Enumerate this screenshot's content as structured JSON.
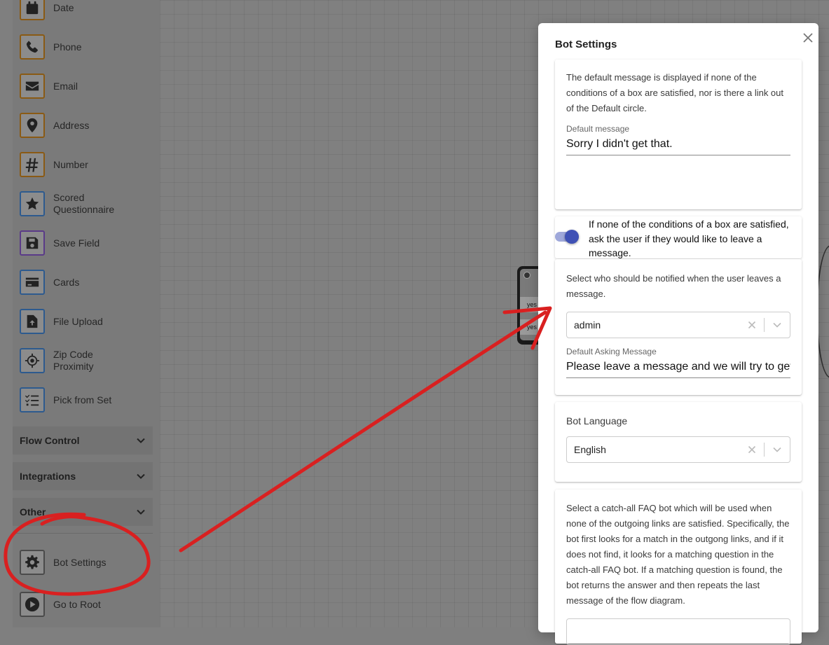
{
  "sidebar": {
    "items": [
      {
        "label": "Date",
        "icon": "calendar-icon"
      },
      {
        "label": "Phone",
        "icon": "phone-icon"
      },
      {
        "label": "Email",
        "icon": "envelope-icon"
      },
      {
        "label": "Address",
        "icon": "map-pin-icon"
      },
      {
        "label": "Number",
        "icon": "hashtag-icon"
      },
      {
        "label": "Scored Questionnaire",
        "icon": "star-icon"
      },
      {
        "label": "Save Field",
        "icon": "floppy-disk-icon"
      },
      {
        "label": "Cards",
        "icon": "credit-card-icon"
      },
      {
        "label": "File Upload",
        "icon": "file-upload-icon"
      },
      {
        "label": "Zip Code Proximity",
        "icon": "crosshairs-icon"
      },
      {
        "label": "Pick from Set",
        "icon": "list-check-icon"
      }
    ],
    "sections": [
      {
        "label": "Flow Control"
      },
      {
        "label": "Integrations"
      },
      {
        "label": "Other"
      }
    ],
    "bottom": [
      {
        "label": "Bot Settings",
        "icon": "gear-icon"
      },
      {
        "label": "Go to Root",
        "icon": "play-icon"
      }
    ]
  },
  "canvas": {
    "node_yes_1": "yes",
    "node_yes_2": "yes"
  },
  "modal": {
    "title": "Bot Settings",
    "default_card": {
      "help": "The default message is displayed if none of the conditions of a box are satisfied, nor is there a link out of the Default circle.",
      "label": "Default message",
      "value": "Sorry I didn't get that."
    },
    "leave_message_toggle": {
      "text": "If none of the conditions of a box are satisfied, ask the user if they would like to leave a message.",
      "checked": true
    },
    "notify_card": {
      "help": "Select who should be notified when the user leaves a message.",
      "select_value": "admin",
      "asking_label": "Default Asking Message",
      "asking_value": "Please leave a message and we will try to get back to you."
    },
    "language_card": {
      "label": "Bot Language",
      "select_value": "English"
    },
    "faq_card": {
      "help": "Select a catch-all FAQ bot which will be used when none of the outgoing links are satisfied. Specifically, the bot first looks for a match in the outgong links, and if it does not find, it looks for a matching question in the catch-all FAQ bot. If a matching question is found, the bot returns the answer and then repeats the last message of the flow diagram."
    }
  },
  "colors": {
    "annotation": "#d92020",
    "toggle_accent": "#3f51b5"
  }
}
